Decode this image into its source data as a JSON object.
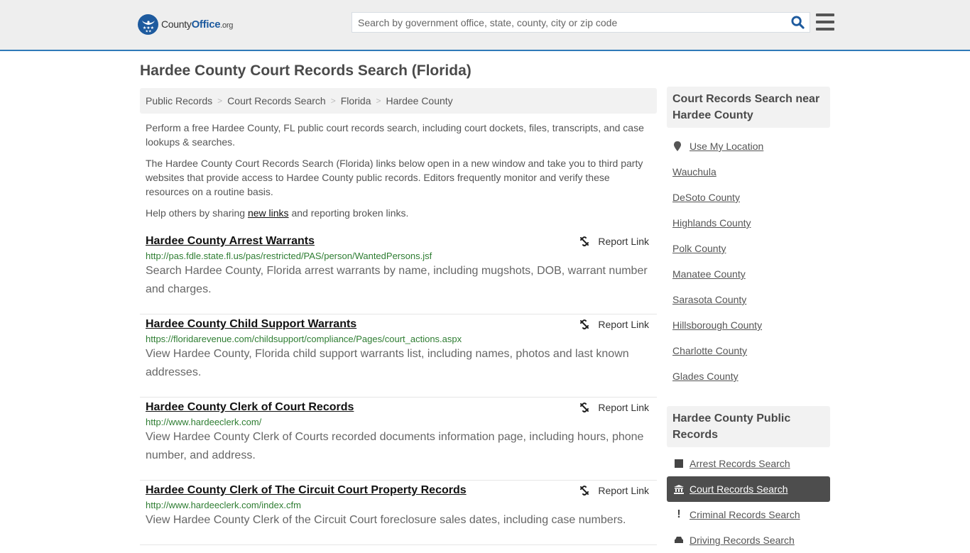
{
  "header": {
    "logo_main": "County",
    "logo_bold": "Office",
    "logo_tld": ".org",
    "search_placeholder": "Search by government office, state, county, city or zip code",
    "accent_color": "#2f7ab8"
  },
  "page_title": "Hardee County Court Records Search (Florida)",
  "breadcrumb": [
    "Public Records",
    "Court Records Search",
    "Florida",
    "Hardee County"
  ],
  "intro": {
    "p1": "Perform a free Hardee County, FL public court records search, including court dockets, files, transcripts, and case lookups & searches.",
    "p2": "The Hardee County Court Records Search (Florida) links below open in a new window and take you to third party websites that provide access to Hardee County public records. Editors frequently monitor and verify these resources on a routine basis.",
    "p3_before": "Help others by sharing ",
    "p3_link": "new links",
    "p3_after": " and reporting broken links."
  },
  "report_label": "Report Link",
  "results": [
    {
      "title": "Hardee County Arrest Warrants",
      "url": "http://pas.fdle.state.fl.us/pas/restricted/PAS/person/WantedPersons.jsf",
      "desc": "Search Hardee County, Florida arrest warrants by name, including mugshots, DOB, warrant number and charges."
    },
    {
      "title": "Hardee County Child Support Warrants",
      "url": "https://floridarevenue.com/childsupport/compliance/Pages/court_actions.aspx",
      "desc": "View Hardee County, Florida child support warrants list, including names, photos and last known addresses."
    },
    {
      "title": "Hardee County Clerk of Court Records",
      "url": "http://www.hardeeclerk.com/",
      "desc": "View Hardee County Clerk of Courts recorded documents information page, including hours, phone number, and address."
    },
    {
      "title": "Hardee County Clerk of The Circuit Court Property Records",
      "url": "http://www.hardeeclerk.com/index.cfm",
      "desc": "View Hardee County Clerk of the Circuit Court foreclosure sales dates, including case numbers."
    }
  ],
  "sidebar_nearby": {
    "title": "Court Records Search near Hardee County",
    "use_location": "Use My Location",
    "items": [
      "Wauchula",
      "DeSoto County",
      "Highlands County",
      "Polk County",
      "Manatee County",
      "Sarasota County",
      "Hillsborough County",
      "Charlotte County",
      "Glades County"
    ]
  },
  "sidebar_public": {
    "title": "Hardee County Public Records",
    "items": [
      {
        "label": "Arrest Records Search",
        "icon": "square-icon",
        "active": false
      },
      {
        "label": "Court Records Search",
        "icon": "courthouse-icon",
        "active": true
      },
      {
        "label": "Criminal Records Search",
        "icon": "exclamation-icon",
        "active": false
      },
      {
        "label": "Driving Records Search",
        "icon": "car-icon",
        "active": false
      }
    ]
  }
}
